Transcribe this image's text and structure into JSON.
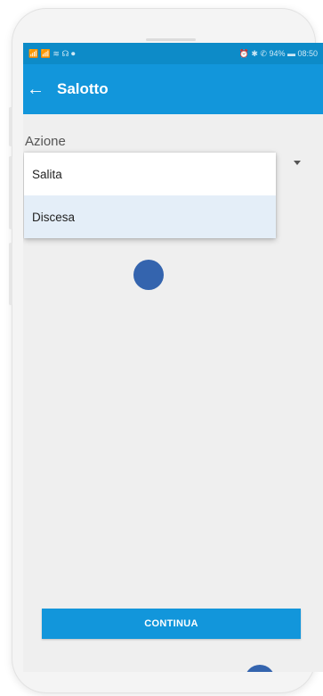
{
  "status_bar": {
    "left_icons": "📶 📶 ≋ ☊ ⏺",
    "right_text": "⏰ ✱ ✆ 94% ▬ 08:50"
  },
  "app_bar": {
    "back_icon": "←",
    "title": "Salotto"
  },
  "form": {
    "label": "Azione"
  },
  "dropdown": {
    "options": [
      "Salita",
      "Discesa"
    ],
    "highlighted": "Discesa"
  },
  "continue_button": {
    "label": "CONTINUA"
  },
  "colors": {
    "primary": "#1296db",
    "status_bar": "#0d8bc8",
    "highlight": "#e4eef8",
    "touch_dot": "#2458a8"
  }
}
